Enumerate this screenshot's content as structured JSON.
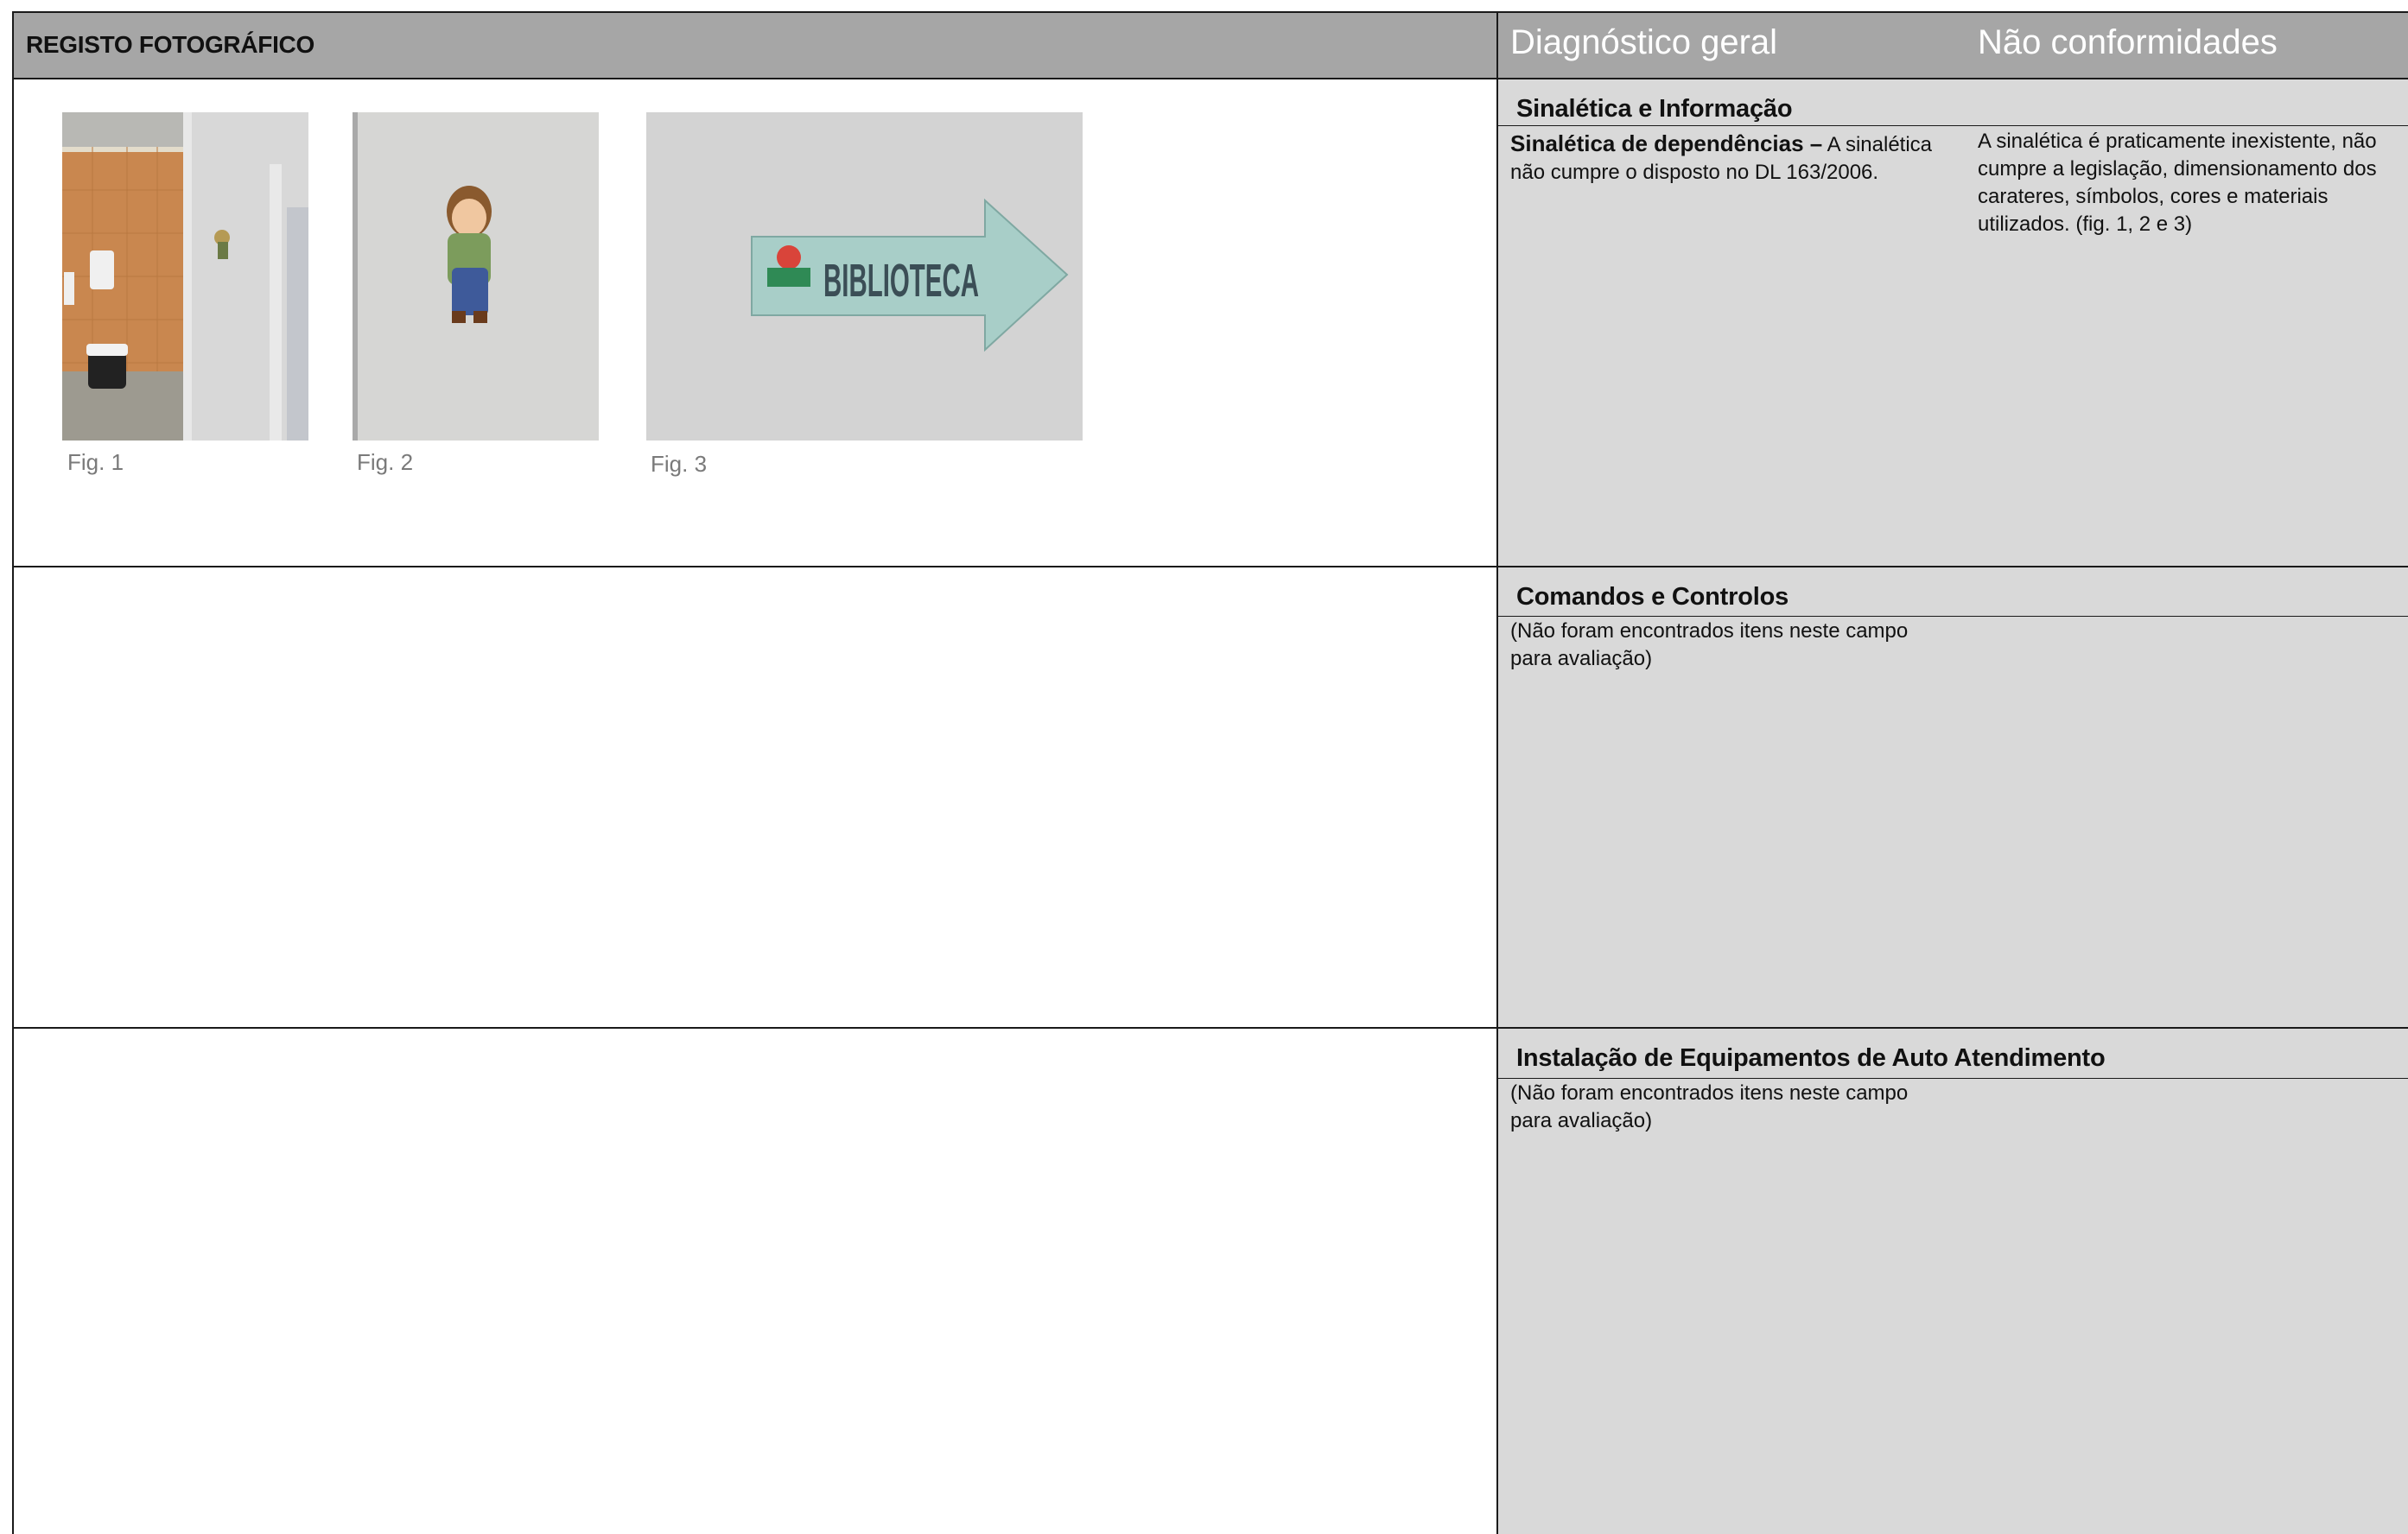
{
  "header": {
    "left_title": "REGISTO FOTOGRÁFICO",
    "col_diagnostico": "Diagnóstico geral",
    "col_nao_conformidades": "Não conformidades"
  },
  "figures": [
    {
      "caption": "Fig. 1",
      "description_icon": "photo-restroom"
    },
    {
      "caption": "Fig. 2",
      "description_icon": "photo-boy-sign"
    },
    {
      "caption": "Fig. 3",
      "description_icon": "photo-library-arrow-sign",
      "sign_text": "BIBLIOTECA"
    }
  ],
  "sections": [
    {
      "title": "Sinalética e Informação",
      "diagnostic_bold": "Sinalética de dependências –",
      "diagnostic_text": " A sinalética não cumpre o disposto no DL 163/2006.",
      "nonconformity": "A sinalética é praticamente inexistente, não cumpre a legislação, dimensionamento dos carateres, símbolos, cores e materiais utilizados. (fig. 1, 2 e 3)"
    },
    {
      "title": "Comandos e Controlos",
      "diagnostic_text": "(Não foram encontrados itens neste campo para avaliação)"
    },
    {
      "title": "Instalação de Equipamentos de Auto Atendimento",
      "diagnostic_text": "(Não foram encontrados itens neste campo para avaliação)"
    }
  ]
}
